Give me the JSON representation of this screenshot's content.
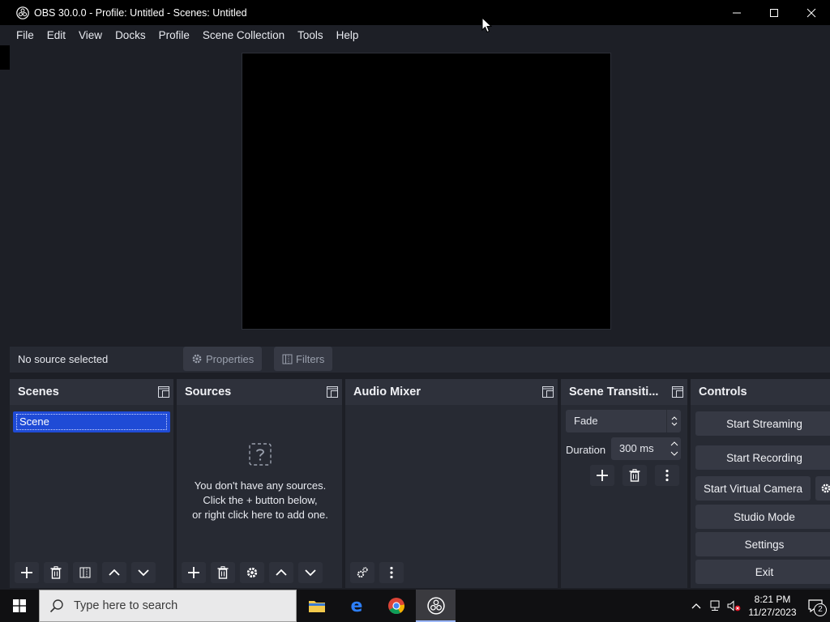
{
  "window": {
    "title": "OBS 30.0.0 - Profile: Untitled - Scenes: Untitled"
  },
  "menu": [
    "File",
    "Edit",
    "View",
    "Docks",
    "Profile",
    "Scene Collection",
    "Tools",
    "Help"
  ],
  "context_bar": {
    "status": "No source selected",
    "properties_label": "Properties",
    "filters_label": "Filters"
  },
  "docks": {
    "scenes": {
      "title": "Scenes",
      "items": [
        "Scene"
      ]
    },
    "sources": {
      "title": "Sources",
      "empty_line1": "You don't have any sources.",
      "empty_line2": "Click the + button below,",
      "empty_line3": "or right click here to add one."
    },
    "audio_mixer": {
      "title": "Audio Mixer"
    },
    "scene_transitions": {
      "title": "Scene Transiti...",
      "transition": "Fade",
      "duration_label": "Duration",
      "duration_value": "300 ms"
    },
    "controls": {
      "title": "Controls",
      "start_streaming": "Start Streaming",
      "start_recording": "Start Recording",
      "start_virtual_camera": "Start Virtual Camera",
      "studio_mode": "Studio Mode",
      "settings": "Settings",
      "exit": "Exit"
    }
  },
  "taskbar": {
    "search_placeholder": "Type here to search",
    "time": "8:21 PM",
    "date": "11/27/2023",
    "notification_count": "2"
  },
  "colors": {
    "accent": "#1f4bd6",
    "dock_bg": "#272a33",
    "main_bg": "#1d1f26"
  }
}
